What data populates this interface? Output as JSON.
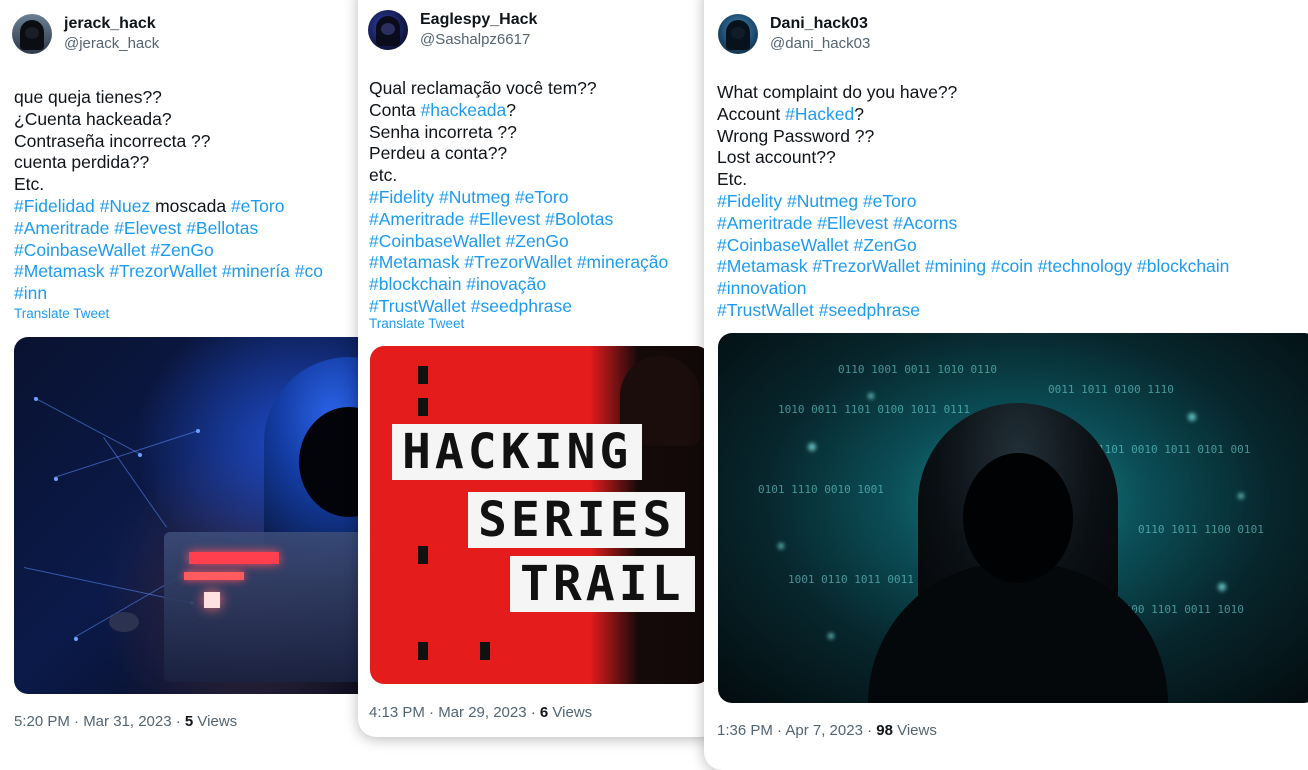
{
  "tweets": [
    {
      "name": "jerack_hack",
      "handle": "@jerack_hack",
      "lines": [
        [
          {
            "t": "que queja tienes??"
          }
        ],
        [
          {
            "t": " ¿Cuenta hackeada?"
          }
        ],
        [
          {
            "t": " Contraseña incorrecta ??"
          }
        ],
        [
          {
            "t": " cuenta perdida??"
          }
        ],
        [
          {
            "t": " Etc."
          }
        ],
        [
          {
            "t": " "
          },
          {
            "t": "#Fidelidad",
            "tag": true
          },
          {
            "t": " "
          },
          {
            "t": "#Nuez",
            "tag": true
          },
          {
            "t": " moscada "
          },
          {
            "t": "#eToro",
            "tag": true
          }
        ],
        [
          {
            "t": " "
          },
          {
            "t": "#Ameritrade",
            "tag": true
          },
          {
            "t": " "
          },
          {
            "t": "#Elevest",
            "tag": true
          },
          {
            "t": " "
          },
          {
            "t": "#Bellotas",
            "tag": true
          }
        ],
        [
          {
            "t": " "
          },
          {
            "t": "#CoinbaseWallet",
            "tag": true
          },
          {
            "t": " "
          },
          {
            "t": "#ZenGo",
            "tag": true
          }
        ],
        [
          {
            "t": " "
          },
          {
            "t": "#Metamask",
            "tag": true
          },
          {
            "t": " "
          },
          {
            "t": "#TrezorWallet",
            "tag": true
          },
          {
            "t": " "
          },
          {
            "t": "#minería",
            "tag": true
          },
          {
            "t": " "
          },
          {
            "t": "#co",
            "tag": true
          }
        ],
        [
          {
            "t": "#inn",
            "tag": true
          }
        ]
      ],
      "translate": "Translate Tweet",
      "time": "5:20 PM · Mar 31, 2023 · ",
      "views_count": "5",
      "views_label": " Views"
    },
    {
      "name": "Eaglespy_Hack",
      "handle": "@Sashalpz6617",
      "lines": [
        [
          {
            "t": "Qual reclamação você tem??"
          }
        ],
        [
          {
            "t": " Conta "
          },
          {
            "t": "#hackeada",
            "tag": true
          },
          {
            "t": "?"
          }
        ],
        [
          {
            "t": " Senha incorreta ??"
          }
        ],
        [
          {
            "t": " Perdeu a conta??"
          }
        ],
        [
          {
            "t": " etc."
          }
        ],
        [
          {
            "t": " "
          },
          {
            "t": "#Fidelity",
            "tag": true
          },
          {
            "t": " "
          },
          {
            "t": "#Nutmeg",
            "tag": true
          },
          {
            "t": " "
          },
          {
            "t": "#eToro",
            "tag": true
          }
        ],
        [
          {
            "t": " "
          },
          {
            "t": "#Ameritrade",
            "tag": true
          },
          {
            "t": " "
          },
          {
            "t": "#Ellevest",
            "tag": true
          },
          {
            "t": " "
          },
          {
            "t": "#Bolotas",
            "tag": true
          }
        ],
        [
          {
            "t": " "
          },
          {
            "t": "#CoinbaseWallet",
            "tag": true
          },
          {
            "t": " "
          },
          {
            "t": "#ZenGo",
            "tag": true
          }
        ],
        [
          {
            "t": " "
          },
          {
            "t": "#Metamask",
            "tag": true
          },
          {
            "t": " "
          },
          {
            "t": "#TrezorWallet",
            "tag": true
          },
          {
            "t": " "
          },
          {
            "t": "#mineração",
            "tag": true
          }
        ],
        [
          {
            "t": "#blockchain",
            "tag": true
          },
          {
            "t": " "
          },
          {
            "t": "#inovação",
            "tag": true
          }
        ],
        [
          {
            "t": " "
          },
          {
            "t": "#TrustWallet",
            "tag": true
          },
          {
            "t": " "
          },
          {
            "t": "#seedphrase",
            "tag": true
          }
        ]
      ],
      "translate": "Translate Tweet",
      "media_text": [
        "HACKING",
        "SERIES",
        "TRAIL"
      ],
      "time": "4:13 PM · Mar 29, 2023 · ",
      "views_count": "6",
      "views_label": " Views"
    },
    {
      "name": "Dani_hack03",
      "handle": "@dani_hack03",
      "lines": [
        [
          {
            "t": "What complaint do you have??"
          }
        ],
        [
          {
            "t": "Account "
          },
          {
            "t": "#Hacked",
            "tag": true
          },
          {
            "t": "?"
          }
        ],
        [
          {
            "t": "Wrong Password ??"
          }
        ],
        [
          {
            "t": "Lost account??"
          }
        ],
        [
          {
            "t": "Etc."
          }
        ],
        [
          {
            "t": "#Fidelity",
            "tag": true
          },
          {
            "t": " "
          },
          {
            "t": "#Nutmeg",
            "tag": true
          },
          {
            "t": " "
          },
          {
            "t": "#eToro",
            "tag": true
          }
        ],
        [
          {
            "t": "#Ameritrade",
            "tag": true
          },
          {
            "t": " "
          },
          {
            "t": "#Ellevest",
            "tag": true
          },
          {
            "t": " "
          },
          {
            "t": "#Acorns",
            "tag": true
          }
        ],
        [
          {
            "t": "#CoinbaseWallet",
            "tag": true
          },
          {
            "t": " "
          },
          {
            "t": "#ZenGo",
            "tag": true
          }
        ],
        [
          {
            "t": "#Metamask",
            "tag": true
          },
          {
            "t": " "
          },
          {
            "t": "#TrezorWallet",
            "tag": true
          },
          {
            "t": " "
          },
          {
            "t": "#mining",
            "tag": true
          },
          {
            "t": " "
          },
          {
            "t": "#coin",
            "tag": true
          },
          {
            "t": " "
          },
          {
            "t": "#technology",
            "tag": true
          },
          {
            "t": " "
          },
          {
            "t": "#blockchain",
            "tag": true
          }
        ],
        [
          {
            "t": "#innovation",
            "tag": true
          }
        ],
        [
          {
            "t": "#TrustWallet",
            "tag": true
          },
          {
            "t": " "
          },
          {
            "t": "#seedphrase",
            "tag": true
          }
        ]
      ],
      "time": "1:36 PM · Apr 7, 2023 · ",
      "views_count": "98",
      "views_label": " Views"
    }
  ],
  "colors": {
    "hashtag": "#1d9bf0",
    "text": "#0f1419",
    "secondary": "#536471"
  }
}
